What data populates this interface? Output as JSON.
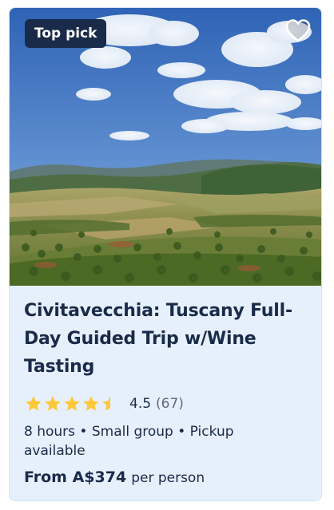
{
  "badge": {
    "label": "Top pick"
  },
  "image": {
    "subject": "Tuscan countryside with olive groves and rolling hills under blue sky"
  },
  "title": "Civitavecchia: Tuscany Full-Day Guided Trip w/Wine Tasting",
  "rating": {
    "value": "4.5",
    "count": "(67)",
    "stars": 4.5,
    "star_color": "#fdc83a"
  },
  "details": "8 hours • Small group • Pickup available",
  "price": {
    "amount": "From A$374",
    "unit": "per person"
  },
  "colors": {
    "navy": "#1a2b49",
    "card_bg": "#e6f0fd",
    "star": "#fdc83a"
  },
  "icons": {
    "wishlist": "heart-outline-icon",
    "star": "star-icon"
  }
}
